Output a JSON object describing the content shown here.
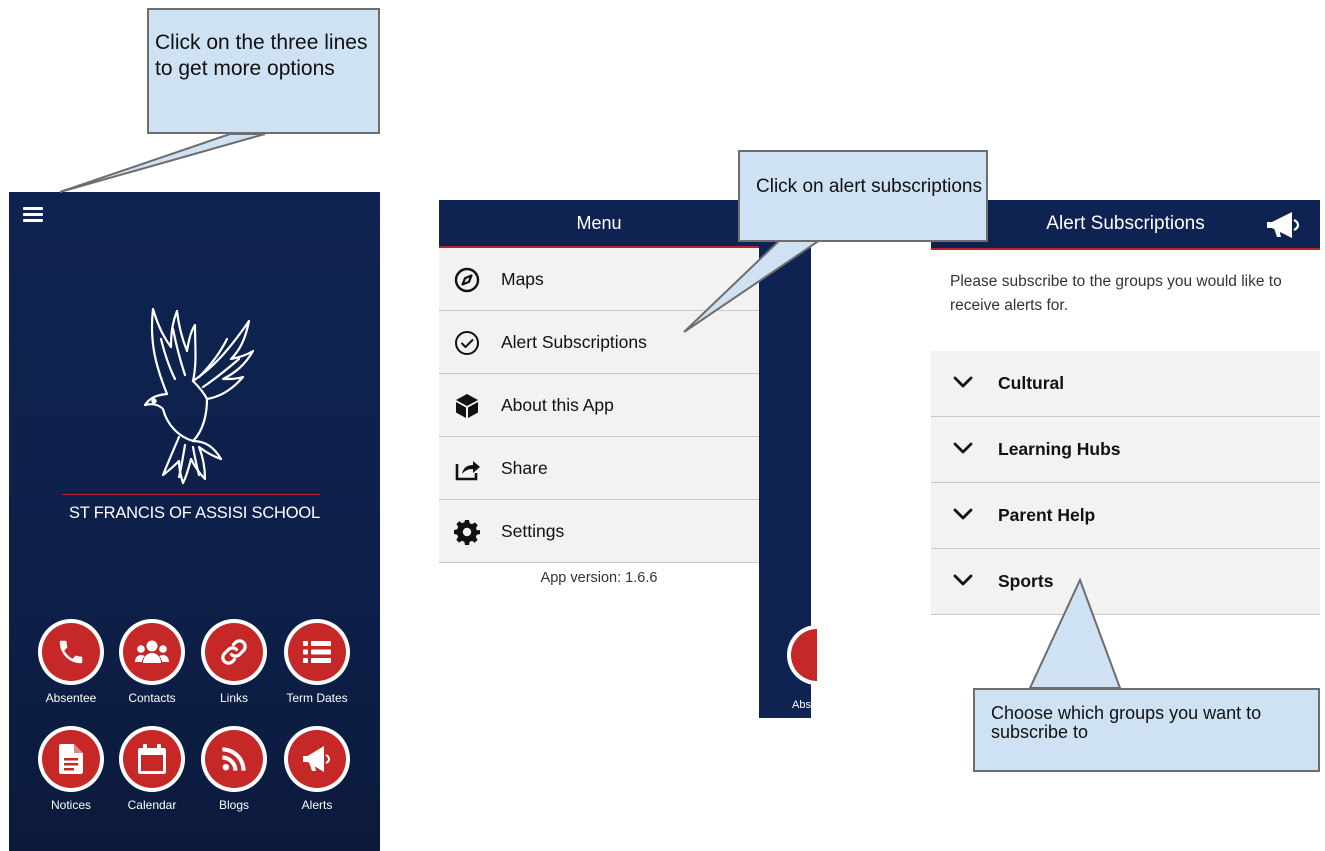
{
  "callouts": {
    "menu_hint": "Click on the three lines to get more options",
    "alert_hint": "Click on alert subscriptions",
    "choose_hint": "Choose which groups you want to subscribe to"
  },
  "home": {
    "school_name": "ST FRANCIS OF ASSISI SCHOOL",
    "tiles": [
      {
        "label": "Absentee",
        "icon": "phone-icon"
      },
      {
        "label": "Contacts",
        "icon": "contacts-icon"
      },
      {
        "label": "Links",
        "icon": "link-icon"
      },
      {
        "label": "Term Dates",
        "icon": "list-icon"
      },
      {
        "label": "Notices",
        "icon": "document-icon"
      },
      {
        "label": "Calendar",
        "icon": "calendar-icon"
      },
      {
        "label": "Blogs",
        "icon": "rss-icon"
      },
      {
        "label": "Alerts",
        "icon": "megaphone-icon"
      }
    ]
  },
  "menu": {
    "title": "Menu",
    "items": [
      {
        "label": "Maps",
        "icon": "compass-icon"
      },
      {
        "label": "Alert Subscriptions",
        "icon": "check-circle-icon"
      },
      {
        "label": "About this App",
        "icon": "cube-icon"
      },
      {
        "label": "Share",
        "icon": "share-icon"
      },
      {
        "label": "Settings",
        "icon": "gear-icon"
      }
    ],
    "version": "App version: 1.6.6",
    "peek_label": "Abs"
  },
  "subscriptions": {
    "title": "Alert Subscriptions",
    "intro": "Please subscribe to the groups you would like to receive alerts for.",
    "groups": [
      "Cultural",
      "Learning Hubs",
      "Parent Help",
      "Sports"
    ]
  },
  "colors": {
    "navy": "#0f2352",
    "red": "#c62828",
    "accent_line": "#b9242a",
    "callout": "#cfe2f3"
  }
}
